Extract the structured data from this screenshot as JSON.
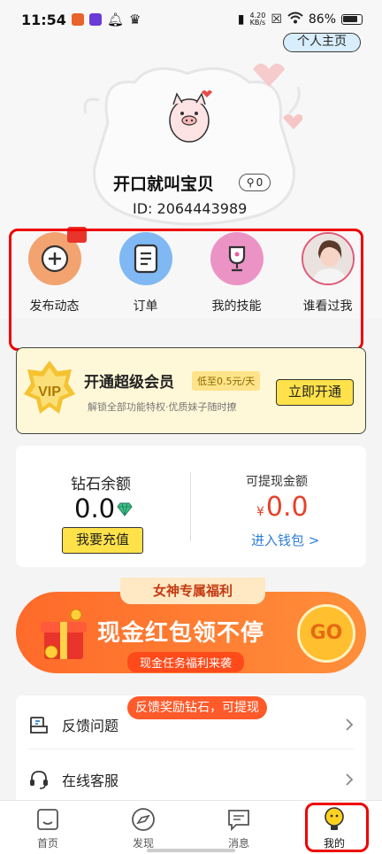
{
  "status_bar": {
    "time": "11:54",
    "net_speed_value": "4.20",
    "net_speed_unit": "KB/s",
    "battery": "86%"
  },
  "header": {
    "profile_button": "个人主页"
  },
  "user": {
    "nickname": "开口就叫宝贝",
    "likes_count": "0",
    "id_text": "ID: 2064443989"
  },
  "actions": [
    {
      "label": "发布动态",
      "icon": "plus-icon"
    },
    {
      "label": "订单",
      "icon": "document-icon"
    },
    {
      "label": "我的技能",
      "icon": "trophy-icon"
    },
    {
      "label": "谁看过我",
      "icon": "visitor-avatar"
    }
  ],
  "vip": {
    "badge": "VIP",
    "title": "开通超级会员",
    "price_tag": "低至0.5元/天",
    "subtitle": "解锁全部功能特权·优质妹子随时撩",
    "button": "立即开通"
  },
  "wallet": {
    "diamond_title": "钻石余额",
    "diamond_amount": "0.0",
    "recharge_button": "我要充值",
    "cash_title": "可提现金额",
    "cash_currency": "¥",
    "cash_amount": "0.0",
    "wallet_link": "进入钱包 >"
  },
  "banner": {
    "top_tag": "女神专属福利",
    "headline": "现金红包领不停",
    "subline": "现金任务福利来袭",
    "go_button": "GO"
  },
  "list": {
    "popup_badge": "反馈奖励钻石，可提现",
    "items": [
      {
        "label": "反馈问题",
        "icon": "feedback-icon"
      },
      {
        "label": "在线客服",
        "icon": "headset-icon"
      }
    ]
  },
  "tabbar": [
    {
      "label": "首页",
      "icon": "home-icon"
    },
    {
      "label": "发现",
      "icon": "compass-icon"
    },
    {
      "label": "消息",
      "icon": "message-icon"
    },
    {
      "label": "我的",
      "icon": "me-icon"
    }
  ],
  "colors": {
    "accent_yellow": "#ffe24a",
    "highlight_red": "#e00000",
    "cash_red": "#e9402a",
    "link_blue": "#2f7fd9",
    "banner_orange": "#ff6a2a"
  }
}
